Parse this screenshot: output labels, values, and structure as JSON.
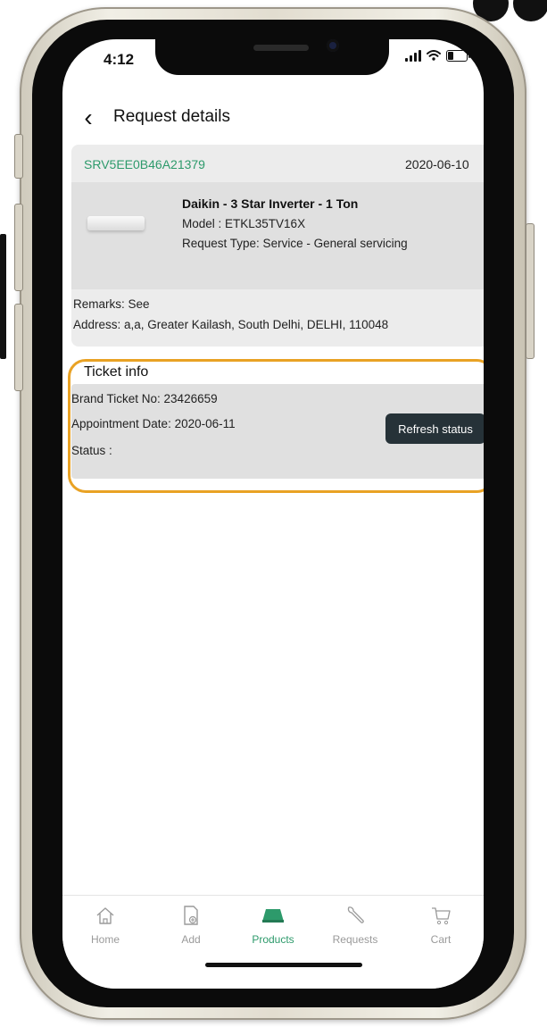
{
  "status_bar": {
    "time": "4:12"
  },
  "header": {
    "title": "Request details"
  },
  "request": {
    "id": "SRV5EE0B46A21379",
    "date": "2020-06-10",
    "product_name": "Daikin - 3 Star Inverter - 1 Ton",
    "model": "Model : ETKL35TV16X",
    "request_type": "Request Type: Service - General servicing",
    "remarks": "Remarks: See",
    "address": "Address: a,a, Greater Kailash, South Delhi, DELHI, 110048"
  },
  "ticket": {
    "title": "Ticket info",
    "brand_ticket": "Brand Ticket No:  23426659",
    "appointment": "Appointment Date:  2020-06-11",
    "status": "Status :",
    "refresh_label": "Refresh status"
  },
  "nav": {
    "items": [
      {
        "label": "Home",
        "icon": "home-icon"
      },
      {
        "label": "Add",
        "icon": "add-icon"
      },
      {
        "label": "Products",
        "icon": "products-icon",
        "active": true
      },
      {
        "label": "Requests",
        "icon": "wrench-icon"
      },
      {
        "label": "Cart",
        "icon": "cart-icon"
      }
    ]
  },
  "colors": {
    "accent_green": "#2d9a6b",
    "highlight_orange": "#e9a224",
    "button_dark": "#263238"
  }
}
